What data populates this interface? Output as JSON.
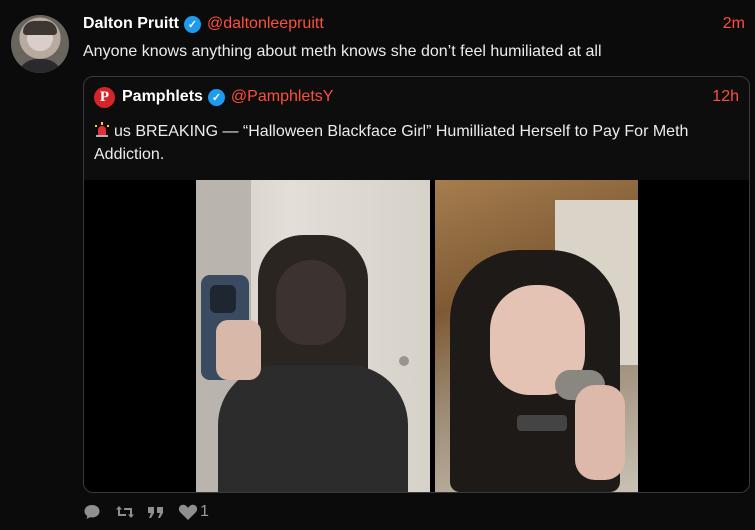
{
  "tweet": {
    "author_name": "Dalton Pruitt",
    "author_handle": "@daltonleepruitt",
    "time": "2m",
    "text": "Anyone knows anything about meth knows she don’t feel humiliated at all"
  },
  "quote": {
    "author_name": "Pamphlets",
    "author_handle": "@PamphletsY",
    "logo_letter": "P",
    "time": "12h",
    "text": "us BREAKING — “Halloween Blackface Girl”  Humilliated Herself to Pay For Meth Addiction."
  },
  "actions": {
    "like_count": "1"
  },
  "colors": {
    "accent": "#ff4f3a",
    "verified": "#1d9bf0",
    "background": "#0b0b0c",
    "logo": "#d6242b"
  },
  "icons": [
    "verified-icon",
    "siren-icon",
    "reply-icon",
    "retweet-icon",
    "quote-icon",
    "like-icon"
  ]
}
